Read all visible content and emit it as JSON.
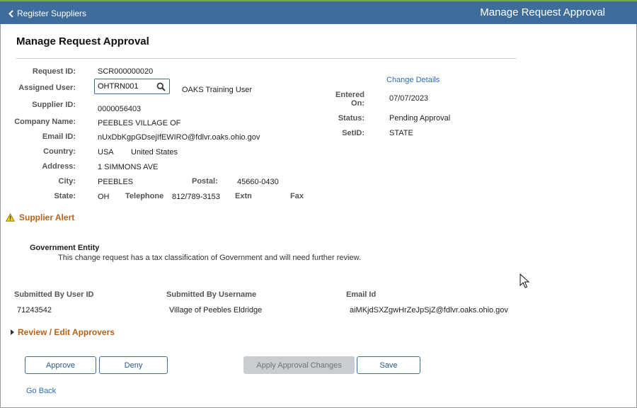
{
  "header": {
    "back_label": "Register Suppliers",
    "title": "Manage Request Approval"
  },
  "page_title": "Manage Request Approval",
  "form": {
    "request_id_label": "Request ID:",
    "request_id": "SCR000000020",
    "assigned_user_label": "Assigned User:",
    "assigned_user_value": "OHTRN001",
    "assigned_user_name": "OAKS Training User",
    "supplier_id_label": "Supplier ID:",
    "supplier_id": "0000056403",
    "company_name_label": "Company Name:",
    "company_name": "PEEBLES VILLAGE OF",
    "email_id_label": "Email ID:",
    "email_id": "nUxDbKgpGDsejIfEWIRO@fdlvr.oaks.ohio.gov",
    "country_label": "Country:",
    "country_code": "USA",
    "country_name": "United States",
    "address_label": "Address:",
    "address": "1 SIMMONS AVE",
    "city_label": "City:",
    "city": "PEEBLES",
    "postal_label": "Postal:",
    "postal": "45660-0430",
    "state_label": "State:",
    "state": "OH",
    "telephone_label": "Telephone",
    "telephone": "812/789-3153",
    "extn_label": "Extn",
    "fax_label": "Fax"
  },
  "details": {
    "change_details_link": "Change Details",
    "entered_on_label_1": "Entered",
    "entered_on_label_2": "On:",
    "entered_on": "07/07/2023",
    "status_label": "Status:",
    "status": "Pending Approval",
    "setid_label": "SetID:",
    "setid": "STATE"
  },
  "alert": {
    "title": "Supplier Alert",
    "icon": "warning-icon",
    "entity_heading": "Government Entity",
    "message": "This change request has a tax classification of Government and will need further review."
  },
  "submitted": {
    "user_id_header": "Submitted By User ID",
    "username_header": "Submitted By Username",
    "email_header": "Email Id",
    "user_id": "71243542",
    "username": "Village of Peebles Eldridge",
    "email": "aiMKjdSXZgwHrZeJpSjZ@fdlvr.oaks.ohio.gov"
  },
  "approvers": {
    "expander_label": "Review / Edit Approvers"
  },
  "buttons": {
    "approve": "Approve",
    "deny": "Deny",
    "apply": "Apply Approval Changes",
    "save": "Save"
  },
  "footer": {
    "go_back": "Go Back"
  },
  "colors": {
    "header_bg": "#3f6d9b",
    "accent_orange": "#b5621b",
    "link_blue": "#2b6fb1"
  }
}
